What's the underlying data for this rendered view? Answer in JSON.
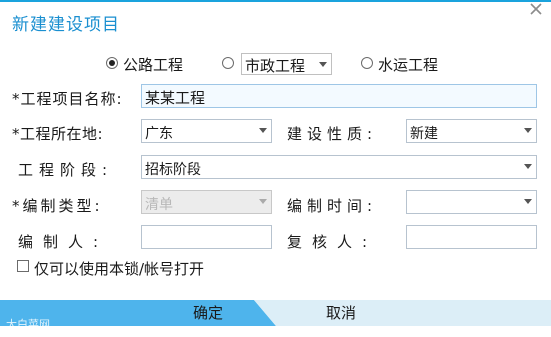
{
  "dialog": {
    "title": "新建建设项目",
    "close_icon": "close-icon"
  },
  "project_type": {
    "options": [
      {
        "label": "公路工程",
        "checked": true
      },
      {
        "label": "市政工程",
        "checked": false,
        "is_select": true
      },
      {
        "label": "水运工程",
        "checked": false
      }
    ]
  },
  "form": {
    "project_name": {
      "label": "*工程项目名称:",
      "value": "某某工程"
    },
    "location": {
      "label": "*工程所在地:",
      "value": "广东"
    },
    "nature": {
      "label": "建设性质:",
      "value": "新建"
    },
    "stage": {
      "label": "工程阶段:",
      "value": "招标阶段"
    },
    "compile_type": {
      "label": "*编制类型:",
      "value": "清单"
    },
    "compile_time": {
      "label": "编制时间:",
      "value": ""
    },
    "compiler": {
      "label": "编制人:",
      "value": ""
    },
    "reviewer": {
      "label": "复核人:",
      "value": ""
    }
  },
  "lock_option": {
    "label": "仅可以使用本锁/帐号打开",
    "checked": false
  },
  "buttons": {
    "ok": "确定",
    "cancel": "取消"
  },
  "watermark": "大白菜网"
}
